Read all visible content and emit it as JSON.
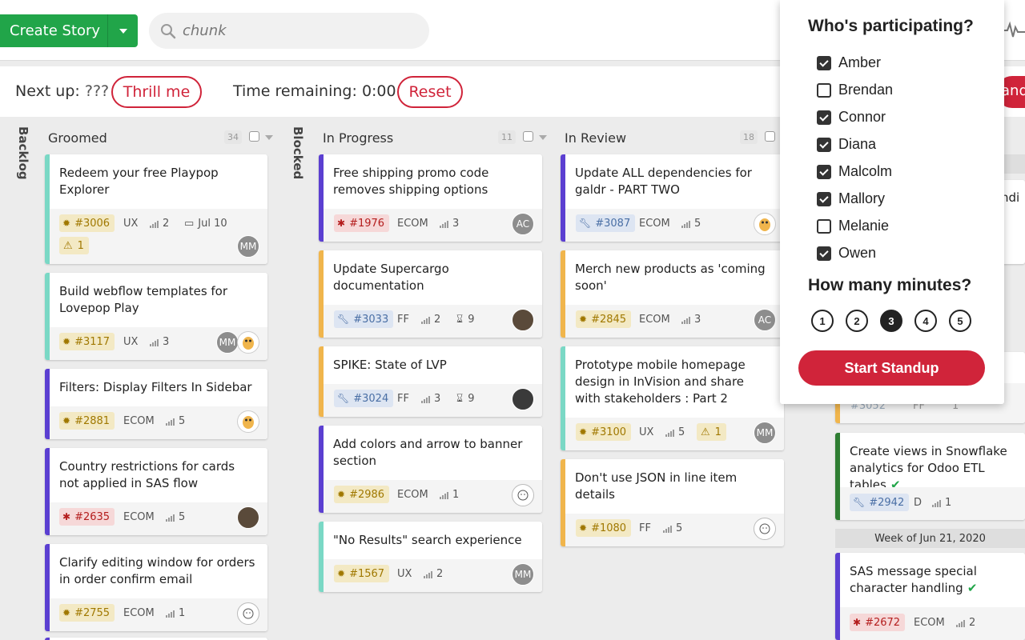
{
  "header": {
    "create_label": "Create Story",
    "search_placeholder": "chunk"
  },
  "standup": {
    "next_up_label": "Next up:",
    "next_up_value": "???",
    "thrill_label": "Thrill me",
    "time_label": "Time remaining:",
    "time_value": "0:00",
    "reset_label": "Reset",
    "edge_button_text": "and"
  },
  "columns": {
    "backlog": {
      "title": "Backlog"
    },
    "groomed": {
      "title": "Groomed",
      "count": "34"
    },
    "blocked": {
      "title": "Blocked"
    },
    "in_progress": {
      "title": "In Progress",
      "count": "11"
    },
    "in_review": {
      "title": "In Review",
      "count": "18"
    }
  },
  "groomed_cards": [
    {
      "title": "Redeem your free Playpop Explorer",
      "id": "#3006",
      "type": "feature",
      "team": "UX",
      "points": "2",
      "date": "Jul 10",
      "warnings": "1",
      "avatar": "MM"
    },
    {
      "title": "Build webflow templates for Lovepop Play",
      "id": "#3117",
      "type": "feature",
      "team": "UX",
      "points": "3",
      "avatar": "MM"
    },
    {
      "title": "Filters: Display Filters In Sidebar",
      "id": "#2881",
      "type": "feature",
      "team": "ECOM",
      "points": "5"
    },
    {
      "title": "Country restrictions for cards not applied in SAS flow",
      "id": "#2635",
      "type": "bug",
      "team": "ECOM",
      "points": "5"
    },
    {
      "title": "Clarify editing window for orders in order confirm email",
      "id": "#2755",
      "type": "feature",
      "team": "ECOM",
      "points": "1"
    }
  ],
  "progress_cards": [
    {
      "title": "Free shipping promo code removes shipping options",
      "id": "#1976",
      "type": "bug",
      "team": "ECOM",
      "points": "3",
      "avatar": "AC"
    },
    {
      "title": "Update Supercargo documentation",
      "id": "#3033",
      "type": "chore",
      "team": "FF",
      "points": "2",
      "days": "9"
    },
    {
      "title": "SPIKE: State of LVP",
      "id": "#3024",
      "type": "chore",
      "team": "FF",
      "points": "3",
      "days": "9"
    },
    {
      "title": "Add colors and arrow to banner section",
      "id": "#2986",
      "type": "feature",
      "team": "ECOM",
      "points": "1"
    },
    {
      "title": "\"No Results\" search experience",
      "id": "#1567",
      "type": "feature",
      "team": "UX",
      "points": "2",
      "avatar": "MM"
    }
  ],
  "review_cards": [
    {
      "title": "Update ALL dependencies for galdr - PART TWO",
      "id": "#3087",
      "type": "chore",
      "team": "ECOM",
      "points": "5"
    },
    {
      "title": "Merch new products as 'coming soon'",
      "id": "#2845",
      "type": "feature",
      "team": "ECOM",
      "points": "3",
      "avatar": "AC"
    },
    {
      "title": "Prototype mobile homepage design in InVision and share with stakeholders : Part 2",
      "id": "#3100",
      "type": "feature",
      "team": "UX",
      "points": "5",
      "warnings": "1",
      "avatar": "MM"
    },
    {
      "title": "Don't use JSON in line item details",
      "id": "#1080",
      "type": "feature",
      "team": "FF",
      "points": "5"
    }
  ],
  "right_cards": [
    {
      "title_partial": "ndi",
      "id_partial": "#3052",
      "team_partial": "FF",
      "points_partial": "1"
    },
    {
      "title": "Create views in Snowflake analytics for Odoo ETL tables",
      "id": "#2942",
      "type": "chore",
      "team": "D",
      "points": "1"
    },
    {
      "title": "SAS message special character handling",
      "id": "#2672",
      "type": "bug",
      "team": "ECOM",
      "points": "2"
    }
  ],
  "week_label": "Week of Jun 21, 2020",
  "popup": {
    "participants_title": "Who's participating?",
    "participants": [
      {
        "name": "Amber",
        "checked": true
      },
      {
        "name": "Brendan",
        "checked": false
      },
      {
        "name": "Connor",
        "checked": true
      },
      {
        "name": "Diana",
        "checked": true
      },
      {
        "name": "Malcolm",
        "checked": true
      },
      {
        "name": "Mallory",
        "checked": true
      },
      {
        "name": "Melanie",
        "checked": false
      },
      {
        "name": "Owen",
        "checked": true
      }
    ],
    "minutes_title": "How many minutes?",
    "minutes": [
      "1",
      "2",
      "3",
      "4",
      "5"
    ],
    "selected_minutes": "3",
    "start_label": "Start Standup"
  },
  "colors": {
    "create": "#21a549",
    "accent_red": "#d0243a",
    "bar_purple": "#5b3fd1",
    "bar_teal": "#7ad8c5",
    "bar_orange": "#f0b54c",
    "bar_green": "#2e7d32"
  }
}
